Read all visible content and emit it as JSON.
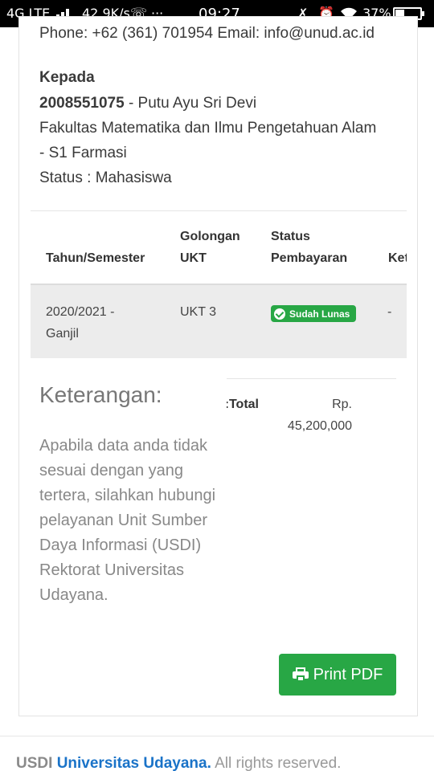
{
  "status_bar": {
    "network": "4G LTE",
    "speed": "42,9K/s",
    "dots": "···",
    "time": "09:27",
    "battery": "37%",
    "battery_level": 0.37
  },
  "contact": {
    "line": "Phone: +62 (361) 701954 Email: info@unud.ac.id"
  },
  "recipient": {
    "heading": "Kepada",
    "nim": "2008551075",
    "name_suffix": " - Putu Ayu Sri Devi",
    "faculty": "Fakultas Matematika dan Ilmu Pengetahuan Alam",
    "program": "- S1 Farmasi",
    "status": "Status : Mahasiswa"
  },
  "table": {
    "headers": {
      "semester": "Tahun/Semester",
      "golongan_l1": "Golongan",
      "golongan_l2": "UKT",
      "status_l1": "Status",
      "status_l2": "Pembayaran",
      "ket": "Ket"
    },
    "row": {
      "semester_l1": "2020/2021 -",
      "semester_l2": "Ganjil",
      "golongan": "UKT 3",
      "status": "Sudah Lunas",
      "ket": "-"
    }
  },
  "total": {
    "label": "Total:",
    "value_l1": "Rp.",
    "value_l2": "45,200,000"
  },
  "keterangan": {
    "title": "Keterangan:",
    "body": "Apabila data anda tidak sesuai dengan yang tertera, silahkan hubungi pelayanan Unit Sumber Daya Informasi (USDI) Rektorat Universitas Udayana."
  },
  "actions": {
    "print_label": "Print PDF"
  },
  "footer": {
    "brand": "USDI",
    "link": "Universitas Udayana.",
    "rest": " All rights reserved."
  }
}
